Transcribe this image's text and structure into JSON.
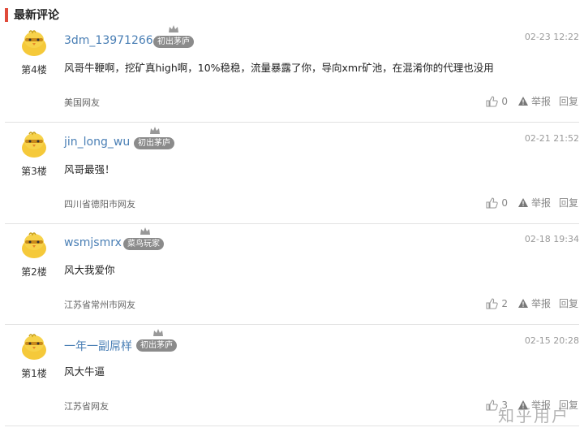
{
  "section_title": "最新评论",
  "watermark": "知乎用户",
  "comments": [
    {
      "floor": "第4楼",
      "username": "3dm_13971266",
      "badge": "初出茅庐",
      "time": "02-23 12:22",
      "content": "风哥牛鞭啊，挖矿真high啊，10%稳稳，流量暴露了你，导向xmr矿池，在混淆你的代理也没用",
      "location": "美国网友",
      "likes": "0",
      "report": "举报",
      "reply": "回复"
    },
    {
      "floor": "第3楼",
      "username": "jin_long_wu",
      "badge": "初出茅庐",
      "time": "02-21 21:52",
      "content": "风哥最强！",
      "location": "四川省德阳市网友",
      "likes": "0",
      "report": "举报",
      "reply": "回复"
    },
    {
      "floor": "第2楼",
      "username": "wsmjsmrx",
      "badge": "菜鸟玩家",
      "time": "02-18 19:34",
      "content": "风大我爱你",
      "location": "江苏省常州市网友",
      "likes": "2",
      "report": "举报",
      "reply": "回复"
    },
    {
      "floor": "第1楼",
      "username": "一年一副屌样",
      "badge": "初出茅庐",
      "time": "02-15 20:28",
      "content": "风大牛逼",
      "location": "江苏省网友",
      "likes": "3",
      "report": "举报",
      "reply": "回复"
    }
  ],
  "colors": {
    "accent": "#e04a3a",
    "username": "#4a7fb5",
    "badge": "#8b8b8b",
    "avatar": "#f5c93a"
  }
}
